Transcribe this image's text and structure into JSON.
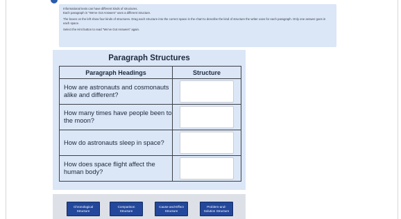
{
  "instructions": {
    "line1": "Informational texts can have different kinds of structures.",
    "line2": "Each paragraph in \"We've Got Answers\" uses a different structure.",
    "line3": "The boxes on the left show four kinds of structures. Drag each structure into the correct space in the chart to describe the kind of structure the writer uses for each paragraph. Only one answer goes in each space.",
    "line4": "Select the Hint button to read \"We've Got Answers\" again."
  },
  "chart": {
    "title": "Paragraph Structures",
    "col_heading": "Paragraph Headings",
    "col_structure": "Structure",
    "rows": [
      {
        "heading": "How are astronauts and cosmonauts alike and different?"
      },
      {
        "heading": "How many times have people been to the moon?"
      },
      {
        "heading": "How do astronauts sleep in space?"
      },
      {
        "heading": "How does space flight affect the human body?"
      }
    ]
  },
  "answer_bank": [
    "Chronological Structure",
    "Comparison Structure",
    "Cause-and-Effect Structure",
    "Problem-and-Solution Structure"
  ],
  "colors": {
    "panel_bg": "#dbe6f6",
    "button_bg": "#23479b",
    "bank_bg": "#dde1e7"
  }
}
